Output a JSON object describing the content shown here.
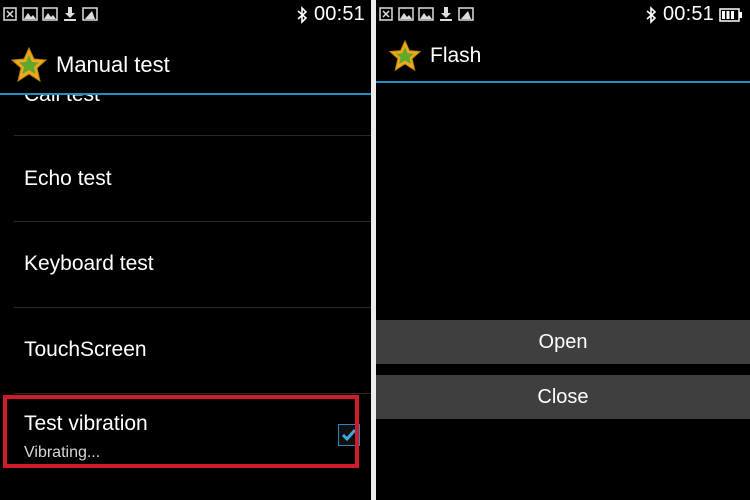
{
  "left": {
    "status_time": "00:51",
    "title": "Manual test",
    "items": [
      {
        "label": "Call test"
      },
      {
        "label": "Echo test"
      },
      {
        "label": "Keyboard test"
      },
      {
        "label": "TouchScreen"
      },
      {
        "label": "Test vibration",
        "subtitle": "Vibrating...",
        "checked": true
      }
    ]
  },
  "right": {
    "status_time": "00:51",
    "title": "Flash",
    "open_label": "Open",
    "close_label": "Close"
  },
  "colors": {
    "accent_line": "#1f8fc4",
    "highlight_box": "#d01c28",
    "checkbox": "#3fa9e0",
    "button_bg": "#3f3f3f"
  },
  "icons": [
    "notification-x-icon",
    "image-icon",
    "download-icon",
    "bluetooth-icon",
    "battery-icon",
    "star-app-icon",
    "checkmark-icon"
  ]
}
